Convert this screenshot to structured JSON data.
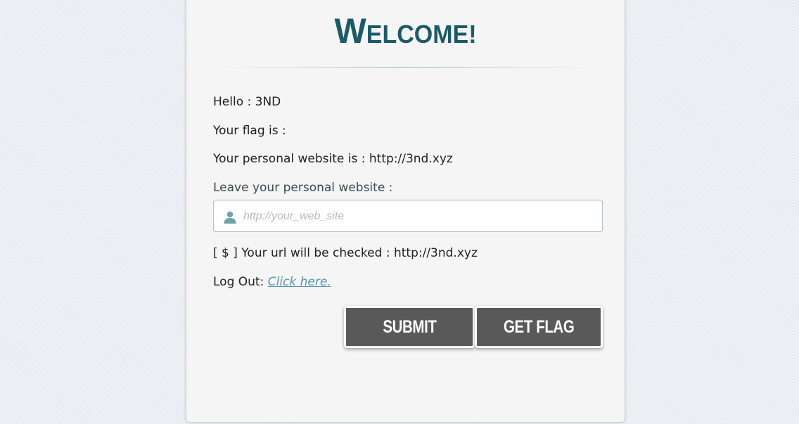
{
  "header": {
    "title_first": "W",
    "title_rest": "ELCOME!"
  },
  "info": {
    "hello_label": "Hello : 3ND",
    "flag_label": "Your flag is :",
    "website_label": "Your personal website is : http://3nd.xyz"
  },
  "form": {
    "website_prompt": "Leave your personal website :",
    "website_placeholder": "http://your_web_site",
    "website_value": "",
    "user_icon": "user-icon"
  },
  "check": {
    "status_text": "[ $ ] Your url will be checked : http://3nd.xyz"
  },
  "logout": {
    "label": "Log Out: ",
    "link_text": "Click here."
  },
  "buttons": {
    "submit_label": "SUBMIT",
    "get_flag_label": "GET FLAG"
  },
  "colors": {
    "title": "#1d5a68",
    "button_bg": "#595959",
    "link": "#5a93b0",
    "card_bg": "#f5f5f5"
  }
}
